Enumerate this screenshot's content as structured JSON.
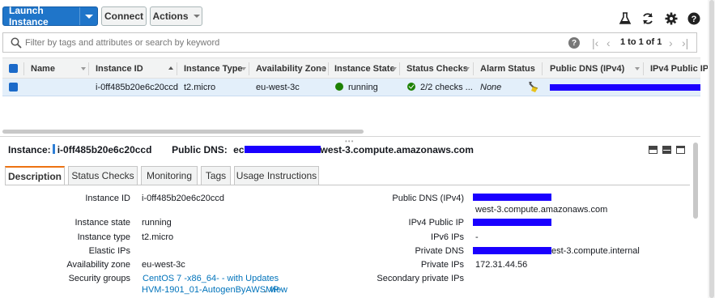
{
  "toolbar": {
    "launch_label": "Launch Instance",
    "connect_label": "Connect",
    "actions_label": "Actions",
    "icons": [
      "flask-icon",
      "refresh-icon",
      "gear-icon",
      "help-icon"
    ]
  },
  "search": {
    "placeholder": "Filter by tags and attributes or search by keyword",
    "pager_text": "1 to 1 of 1"
  },
  "table": {
    "columns": [
      "Name",
      "Instance ID",
      "Instance Type",
      "Availability Zone",
      "Instance State",
      "Status Checks",
      "Alarm Status",
      "Public DNS (IPv4)",
      "IPv4 Public IP"
    ],
    "row": {
      "name": "",
      "instance_id": "i-0ff485b20e6c20ccd",
      "instance_type": "t2.micro",
      "availability_zone": "eu-west-3c",
      "instance_state": "running",
      "status_checks": "2/2 checks ...",
      "alarm_status": "None"
    }
  },
  "detail": {
    "instance_label": "Instance:",
    "instance_id": "i-0ff485b20e6c20ccd",
    "public_dns_label": "Public DNS:",
    "public_dns_prefix": "ec",
    "public_dns_suffix": "west-3.compute.amazonaws.com",
    "tabs": [
      "Description",
      "Status Checks",
      "Monitoring",
      "Tags",
      "Usage Instructions"
    ],
    "left": {
      "instance_id_label": "Instance ID",
      "instance_id_value": "i-0ff485b20e6c20ccd",
      "instance_state_label": "Instance state",
      "instance_state_value": "running",
      "instance_type_label": "Instance type",
      "instance_type_value": "t2.micro",
      "elastic_ips_label": "Elastic IPs",
      "availability_zone_label": "Availability zone",
      "availability_zone_value": "eu-west-3c",
      "security_groups_label": "Security groups",
      "security_group_link": "CentOS 7 -x86_64- - with Updates",
      "security_group_link2": "HVM-1901_01-AutogenByAWSMP-",
      "view_link": "view"
    },
    "right": {
      "public_dns_label": "Public DNS (IPv4)",
      "public_dns_value": "west-3.compute.amazonaws.com",
      "ipv4_public_ip_label": "IPv4 Public IP",
      "ipv6_ips_label": "IPv6 IPs",
      "ipv6_ips_value": "-",
      "private_dns_label": "Private DNS",
      "private_dns_value": "est-3.compute.internal",
      "private_ips_label": "Private IPs",
      "private_ips_value": "172.31.44.56",
      "secondary_private_ips_label": "Secondary private IPs"
    }
  },
  "colors": {
    "primary": "#1f75c9",
    "redaction": "#1a00ff",
    "running": "#1d8102",
    "active_tab": "#ec7211",
    "link": "#0073bb"
  }
}
